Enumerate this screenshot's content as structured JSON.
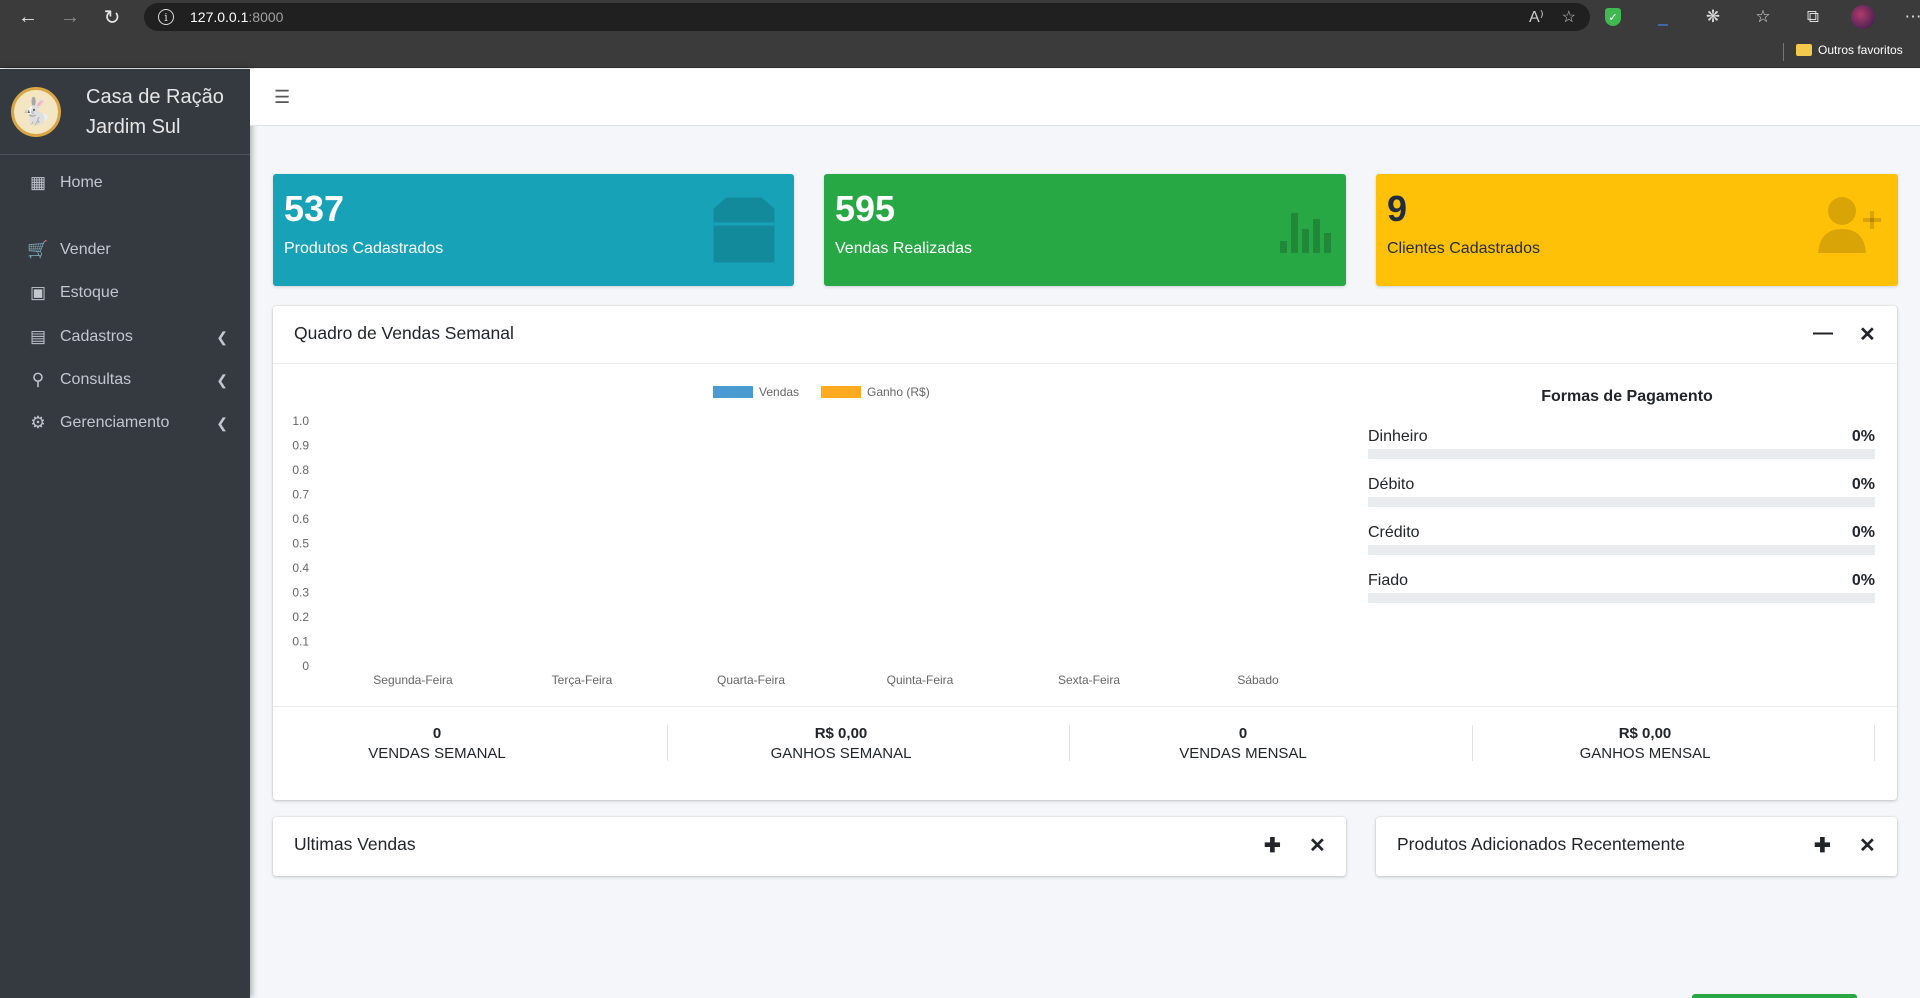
{
  "browser": {
    "url_host": "127.0.0.1",
    "url_port": ":8000",
    "bookmark_folder": "Outros favoritos"
  },
  "sidebar": {
    "brand_line1": "Casa de Ração",
    "brand_line2": "Jardim Sul",
    "items": [
      {
        "label": "Home",
        "icon": "grid-icon"
      },
      {
        "label": "Vender",
        "icon": "cart-icon"
      },
      {
        "label": "Estoque",
        "icon": "box-icon"
      },
      {
        "label": "Cadastros",
        "icon": "id-card-icon"
      },
      {
        "label": "Consultas",
        "icon": "search-icon"
      },
      {
        "label": "Gerenciamento",
        "icon": "gears-icon"
      }
    ]
  },
  "stats_boxes": [
    {
      "value": "537",
      "label": "Produtos Cadastrados",
      "icon": "box-icon",
      "color": "#17a2b8"
    },
    {
      "value": "595",
      "label": "Vendas Realizadas",
      "icon": "bar-chart-icon",
      "color": "#28a745"
    },
    {
      "value": "9",
      "label": "Clientes Cadastrados",
      "icon": "user-plus-icon",
      "color": "#ffc107"
    }
  ],
  "weekly_card": {
    "title": "Quadro de Vendas Semanal",
    "payment_title": "Formas de Pagamento",
    "payments": [
      {
        "label": "Dinheiro",
        "value": "0%",
        "percent": 0
      },
      {
        "label": "Débito",
        "value": "0%",
        "percent": 0
      },
      {
        "label": "Crédito",
        "value": "0%",
        "percent": 0
      },
      {
        "label": "Fiado",
        "value": "0%",
        "percent": 0
      }
    ],
    "footer": [
      {
        "value": "0",
        "label": "VENDAS SEMANAL"
      },
      {
        "value": "R$ 0,00",
        "label": "GANHOS SEMANAL"
      },
      {
        "value": "0",
        "label": "VENDAS MENSAL"
      },
      {
        "value": "R$ 0,00",
        "label": "GANHOS MENSAL"
      }
    ]
  },
  "recent_sales_card": {
    "title": "Ultimas Vendas"
  },
  "recent_products_card": {
    "title": "Produtos Adicionados Recentemente"
  },
  "chart_data": {
    "type": "bar",
    "categories": [
      "Segunda-Feira",
      "Terça-Feira",
      "Quarta-Feira",
      "Quinta-Feira",
      "Sexta-Feira",
      "Sábado"
    ],
    "series": [
      {
        "name": "Vendas",
        "values": [
          0,
          0,
          0,
          0,
          0,
          0
        ],
        "color": "#4a9bd1"
      },
      {
        "name": "Ganho (R$)",
        "values": [
          0,
          0,
          0,
          0,
          0,
          0
        ],
        "color": "#ffaa1f"
      }
    ],
    "ylim": [
      0,
      1.0
    ],
    "yticks": [
      "1.0",
      "0.9",
      "0.8",
      "0.7",
      "0.6",
      "0.5",
      "0.4",
      "0.3",
      "0.2",
      "0.1",
      "0"
    ],
    "legend": "top-center",
    "grid": false
  }
}
